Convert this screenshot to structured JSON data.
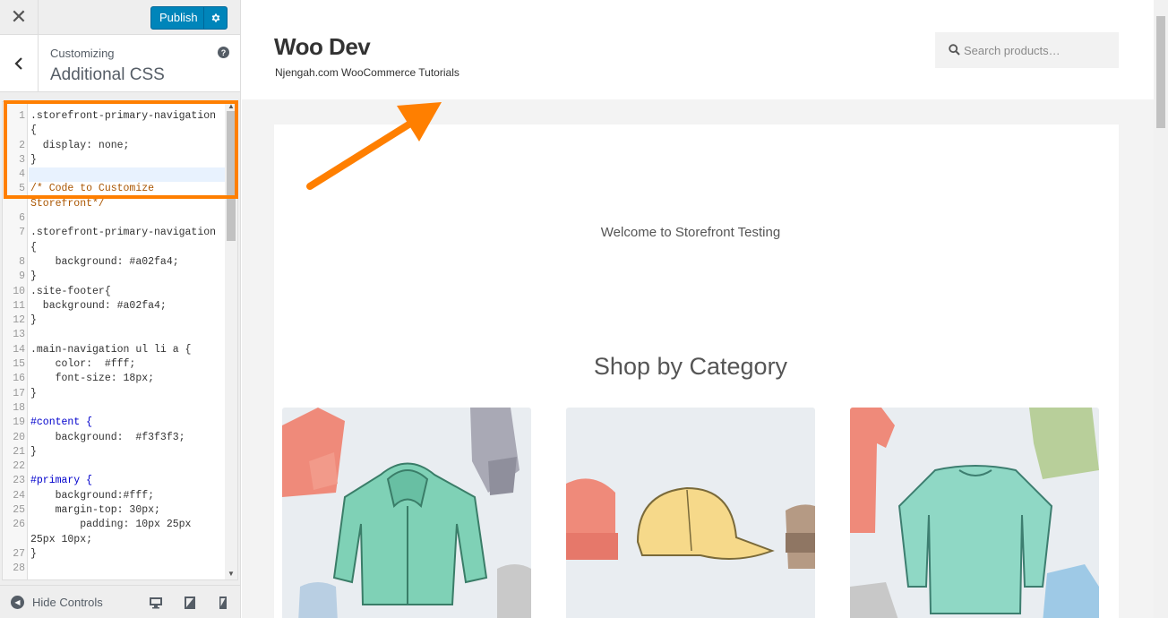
{
  "customizer": {
    "close_label": "✕",
    "publish_label": "Publish",
    "crumb_small": "Customizing",
    "crumb_title": "Additional CSS",
    "help_label": "?",
    "hide_controls_label": "Hide Controls"
  },
  "css_lines": [
    {
      "n": "1",
      "t": ".storefront-primary-navigation",
      "cls": "sel"
    },
    {
      "n": "",
      "t": "{",
      "cls": "sel"
    },
    {
      "n": "2",
      "t": "  display: none;",
      "cls": "prop"
    },
    {
      "n": "3",
      "t": "}",
      "cls": "sel"
    },
    {
      "n": "4",
      "t": "",
      "cls": "sel"
    },
    {
      "n": "5",
      "t": "/* Code to Customize",
      "cls": "cm"
    },
    {
      "n": "",
      "t": "Storefront*/",
      "cls": "cm"
    },
    {
      "n": "6",
      "t": "",
      "cls": "sel"
    },
    {
      "n": "7",
      "t": ".storefront-primary-navigation",
      "cls": "sel"
    },
    {
      "n": "",
      "t": "{",
      "cls": "sel"
    },
    {
      "n": "8",
      "t": "    background: #a02fa4;",
      "cls": "prop"
    },
    {
      "n": "9",
      "t": "}",
      "cls": "sel"
    },
    {
      "n": "10",
      "t": ".site-footer{",
      "cls": "sel"
    },
    {
      "n": "11",
      "t": "  background: #a02fa4;",
      "cls": "prop"
    },
    {
      "n": "12",
      "t": "}",
      "cls": "sel"
    },
    {
      "n": "13",
      "t": "",
      "cls": "sel"
    },
    {
      "n": "14",
      "t": ".main-navigation ul li a {",
      "cls": "sel"
    },
    {
      "n": "15",
      "t": "    color:  #fff;",
      "cls": "prop"
    },
    {
      "n": "16",
      "t": "    font-size: 18px;",
      "cls": "prop"
    },
    {
      "n": "17",
      "t": "}",
      "cls": "sel"
    },
    {
      "n": "18",
      "t": "",
      "cls": "sel"
    },
    {
      "n": "19",
      "t": "#content {",
      "cls": "idsel"
    },
    {
      "n": "20",
      "t": "    background:  #f3f3f3;",
      "cls": "prop"
    },
    {
      "n": "21",
      "t": "}",
      "cls": "sel"
    },
    {
      "n": "22",
      "t": "",
      "cls": "sel"
    },
    {
      "n": "23",
      "t": "#primary {",
      "cls": "idsel"
    },
    {
      "n": "24",
      "t": "    background:#fff;",
      "cls": "prop"
    },
    {
      "n": "25",
      "t": "    margin-top: 30px;",
      "cls": "prop"
    },
    {
      "n": "26",
      "t": "        padding: 10px 25px",
      "cls": "prop"
    },
    {
      "n": "",
      "t": "25px 10px;",
      "cls": "prop"
    },
    {
      "n": "27",
      "t": "}",
      "cls": "sel"
    },
    {
      "n": "28",
      "t": "",
      "cls": "sel"
    }
  ],
  "active_line": "4",
  "site": {
    "title": "Woo Dev",
    "tagline": "Njengah.com WooCommerce Tutorials",
    "search_placeholder": "Search products…",
    "welcome": "Welcome to Storefront Testing",
    "shop_heading": "Shop by Category"
  },
  "colors": {
    "publish": "#0085ba",
    "highlight": "#ff7f00",
    "arrow": "#ff7f00"
  }
}
